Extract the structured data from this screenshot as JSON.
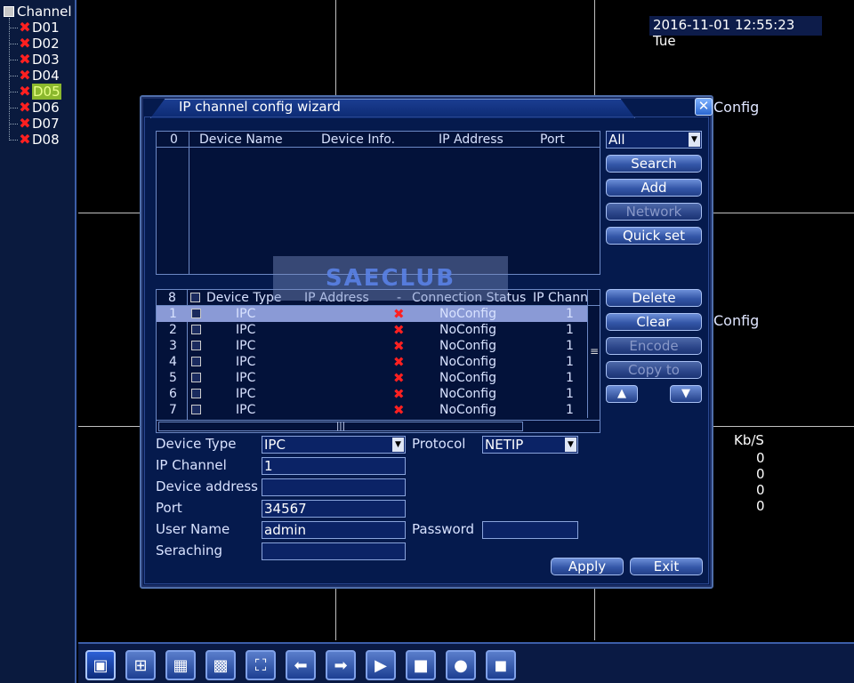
{
  "tree": {
    "root_label": "Channel",
    "items": [
      {
        "label": "D01",
        "status_icon": "red-x-icon"
      },
      {
        "label": "D02",
        "status_icon": "red-x-icon"
      },
      {
        "label": "D03",
        "status_icon": "red-x-icon"
      },
      {
        "label": "D04",
        "status_icon": "red-x-icon"
      },
      {
        "label": "D05",
        "status_icon": "red-x-icon",
        "selected": true
      },
      {
        "label": "D06",
        "status_icon": "red-x-icon"
      },
      {
        "label": "D07",
        "status_icon": "red-x-icon"
      },
      {
        "label": "D08",
        "status_icon": "red-x-icon"
      }
    ]
  },
  "datetime": "2016-11-01 12:55:23 Tue",
  "background": {
    "config_label_1": "Config",
    "config_label_2": "Config",
    "kbs_label": "Kb/S",
    "kbs_values": [
      "0",
      "0",
      "0",
      "0"
    ]
  },
  "dialog": {
    "title": "IP channel config wizard",
    "close_icon": "close-icon",
    "search_table": {
      "headers": {
        "count": "0",
        "device_name": "Device Name",
        "device_info": "Device Info.",
        "ip_address": "IP Address",
        "port": "Port"
      }
    },
    "filter_select": "All",
    "buttons": {
      "search": "Search",
      "add": "Add",
      "network": "Network",
      "quick_set": "Quick set",
      "delete": "Delete",
      "clear": "Clear",
      "encode": "Encode",
      "copy_to": "Copy to",
      "apply": "Apply",
      "exit": "Exit"
    },
    "channel_table": {
      "headers": {
        "count": "8",
        "device_type": "Device Type",
        "ip_address": "IP Address",
        "dash": "-",
        "connection_status": "Connection Status",
        "ip_channel": "IP Chann"
      },
      "rows": [
        {
          "num": "1",
          "device_type": "IPC",
          "status": "NoConfig",
          "ip_channel": "1"
        },
        {
          "num": "2",
          "device_type": "IPC",
          "status": "NoConfig",
          "ip_channel": "1"
        },
        {
          "num": "3",
          "device_type": "IPC",
          "status": "NoConfig",
          "ip_channel": "1"
        },
        {
          "num": "4",
          "device_type": "IPC",
          "status": "NoConfig",
          "ip_channel": "1"
        },
        {
          "num": "5",
          "device_type": "IPC",
          "status": "NoConfig",
          "ip_channel": "1"
        },
        {
          "num": "6",
          "device_type": "IPC",
          "status": "NoConfig",
          "ip_channel": "1"
        },
        {
          "num": "7",
          "device_type": "IPC",
          "status": "NoConfig",
          "ip_channel": "1"
        }
      ]
    },
    "form": {
      "device_type_label": "Device Type",
      "device_type_value": "IPC",
      "protocol_label": "Protocol",
      "protocol_value": "NETIP",
      "ip_channel_label": "IP Channel",
      "ip_channel_value": "1",
      "device_address_label": "Device address",
      "device_address_value": "",
      "port_label": "Port",
      "port_value": "34567",
      "user_name_label": "User Name",
      "user_name_value": "admin",
      "password_label": "Password",
      "password_value": "",
      "searching_label": "Seraching",
      "searching_value": ""
    }
  },
  "watermark": "SAECLUB",
  "toolbar": {
    "buttons": [
      {
        "icon": "single-view-icon",
        "active": true
      },
      {
        "icon": "quad-view-icon"
      },
      {
        "icon": "six-view-icon"
      },
      {
        "icon": "nine-view-icon"
      },
      {
        "icon": "fullscreen-icon"
      },
      {
        "icon": "previous-icon"
      },
      {
        "icon": "next-icon"
      },
      {
        "icon": "playback-icon"
      },
      {
        "icon": "record-stop-icon"
      },
      {
        "icon": "record-play-icon"
      },
      {
        "icon": "record-stop-icon"
      }
    ]
  }
}
